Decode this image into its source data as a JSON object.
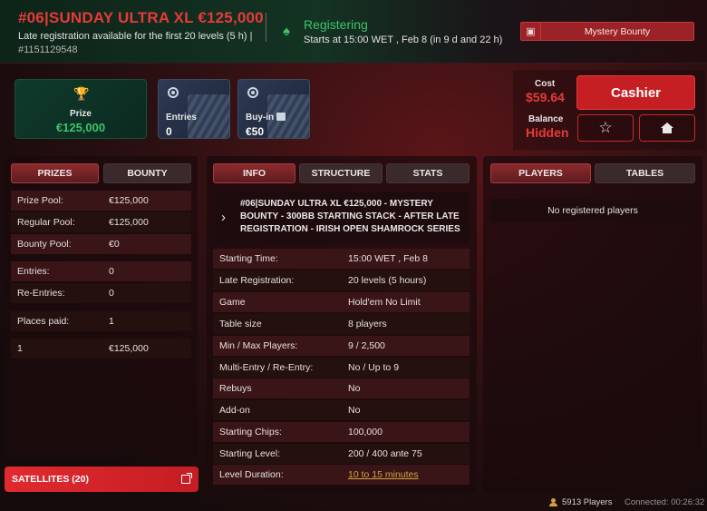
{
  "header": {
    "title": "#06|SUNDAY ULTRA XL €125,000",
    "subtitle": "Late registration available for the first 20 levels (5 h) |",
    "tournament_id": "#1151129548",
    "status": "Registering",
    "starts": "Starts at 15:00 WET , Feb 8 (in 9 d and 22 h)",
    "bounty_badge": "Mystery Bounty",
    "status_icon": "spade-icon",
    "bounty_icon": "briefcase-icon"
  },
  "cards": {
    "prize_label": "Prize",
    "prize_value": "€125,000",
    "entries_label": "Entries",
    "entries_value": "0",
    "buyin_label": "Buy-in",
    "buyin_value": "€50"
  },
  "account": {
    "cost_label": "Cost",
    "cost_value": "$59.64",
    "balance_label": "Balance",
    "balance_value": "Hidden",
    "cashier_label": "Cashier",
    "favorite_icon": "star-icon",
    "lobby_icon": "home-icon"
  },
  "left": {
    "tabs": [
      "PRIZES",
      "BOUNTY"
    ],
    "rows": [
      {
        "k": "Prize Pool:",
        "v": "€125,000"
      },
      {
        "k": "Regular Pool:",
        "v": "€125,000"
      },
      {
        "k": "Bounty Pool:",
        "v": "€0"
      },
      {
        "k": "Entries:",
        "v": "0"
      },
      {
        "k": "Re-Entries:",
        "v": "0"
      },
      {
        "k": "Places paid:",
        "v": "1"
      },
      {
        "k": "1",
        "v": "€125,000"
      }
    ],
    "satellites": "SATELLITES (20)"
  },
  "mid": {
    "tabs": [
      "INFO",
      "STRUCTURE",
      "STATS"
    ],
    "name": "#06|SUNDAY ULTRA XL €125,000 - MYSTERY BOUNTY - 300BB STARTING STACK - AFTER LATE REGISTRATION - IRISH OPEN SHAMROCK SERIES ...",
    "rows": [
      {
        "k": "Starting Time:",
        "v": "15:00 WET , Feb 8"
      },
      {
        "k": "Late Registration:",
        "v": "20 levels (5 hours)"
      },
      {
        "k": "Game",
        "v": "Hold'em No Limit"
      },
      {
        "k": "Table size",
        "v": "8 players"
      },
      {
        "k": "Min / Max Players:",
        "v": "9 / 2,500"
      },
      {
        "k": "Multi-Entry / Re-Entry:",
        "v": "No / Up to 9"
      },
      {
        "k": "Rebuys",
        "v": "No"
      },
      {
        "k": "Add-on",
        "v": "No"
      },
      {
        "k": "Starting Chips:",
        "v": "100,000"
      },
      {
        "k": "Starting Level:",
        "v": "200 / 400 ante 75"
      },
      {
        "k": "Level Duration:",
        "v": "10 to 15 minutes"
      }
    ]
  },
  "right": {
    "tabs": [
      "PLAYERS",
      "TABLES"
    ],
    "empty": "No registered players"
  },
  "footer": {
    "players": "5913 Players",
    "connected": "Connected: 00:26:32"
  },
  "colors": {
    "accent_red": "#e63a3a",
    "accent_green": "#3ec46a",
    "cashier_red": "#c51f24",
    "link_gold": "#d4a13c"
  }
}
